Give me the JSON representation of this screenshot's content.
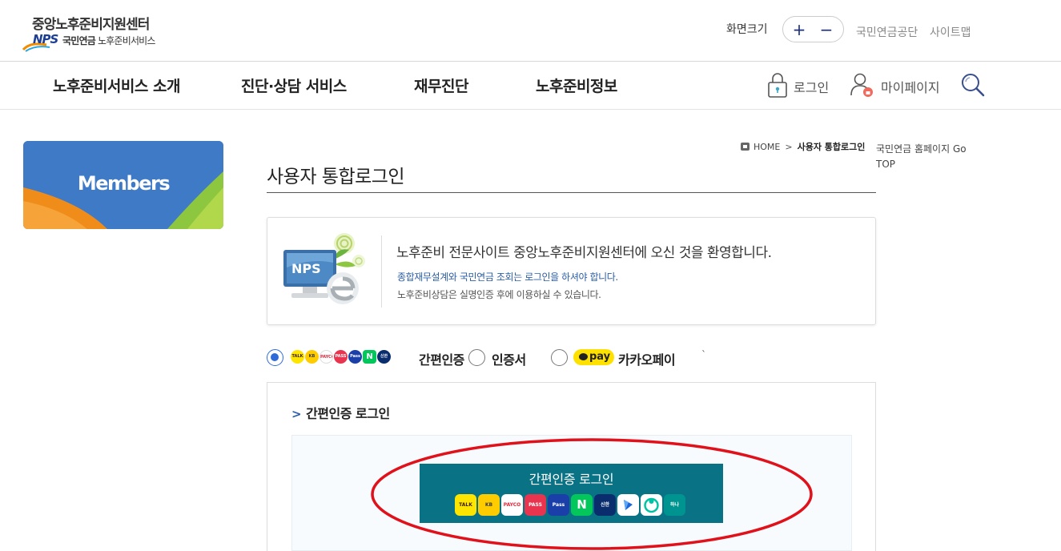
{
  "header": {
    "logo_title": "중앙노후준비지원센터",
    "logo_brand": "NPS",
    "logo_sub_bold": "국민연금",
    "logo_sub": "노후준비서비스",
    "zoom_label": "화면크기",
    "zoom_plus": "+",
    "zoom_minus": "−",
    "links": [
      "국민연금공단",
      "사이트맵"
    ]
  },
  "nav": {
    "items": [
      "노후준비서비스 소개",
      "진단·상담 서비스",
      "재무진단",
      "노후준비정보"
    ],
    "login_label": "로그인",
    "mypage_label": "마이페이지"
  },
  "side_banner": {
    "text": "Members"
  },
  "breadcrumb": {
    "home": "HOME",
    "sep": ">",
    "current": "사용자 통합로그인"
  },
  "go_links": "국민연금 홈페이지 Go TOP",
  "page_title": "사용자 통합로그인",
  "welcome": {
    "illust_text": "NPS",
    "main": "노후준비 전문사이트 중앙노후준비지원센터에 오신 것을 환영합니다.",
    "note1": "종합재무설계와 국민연금 조회는 로그인을 하셔야 합니다.",
    "note2": "노후준비상담은 실명인증 후에 이용하실 수 있습니다."
  },
  "login_methods": {
    "options": [
      "간편인증",
      "인증서",
      "카카오페이"
    ],
    "selected": "간편인증",
    "kakaopay_badge": "pay",
    "stray_mark": "`"
  },
  "simple_auth": {
    "heading_chevron": ">",
    "heading": "간편인증 로그인",
    "button_label": "간편인증 로그인",
    "provider_icons": [
      {
        "name": "kakao-talk",
        "text": "TALK",
        "bg": "#fee500",
        "fg": "#3c1e1e"
      },
      {
        "name": "kb",
        "text": "KB",
        "bg": "#ffcc00",
        "fg": "#3c3c3c"
      },
      {
        "name": "payco",
        "text": "PAYCO",
        "bg": "#ffffff",
        "fg": "#e0293b"
      },
      {
        "name": "pass",
        "text": "PASS",
        "bg": "#e8344e",
        "fg": "#ffffff"
      },
      {
        "name": "samsung-pass",
        "text": "Pass",
        "bg": "#1a3fa8",
        "fg": "#ffffff"
      },
      {
        "name": "naver",
        "text": "N",
        "bg": "#03c75a",
        "fg": "#ffffff"
      },
      {
        "name": "shinhan",
        "text": "신한",
        "bg": "#0a2d6e",
        "fg": "#ffffff"
      },
      {
        "name": "toss",
        "text": "",
        "bg": "#ffffff",
        "fg": "#1b64da"
      },
      {
        "name": "banksalad",
        "text": "",
        "bg": "#ffffff",
        "fg": "#00c3a5"
      },
      {
        "name": "hana",
        "text": "하나",
        "bg": "#009490",
        "fg": "#ffffff"
      }
    ]
  },
  "colors": {
    "accent_blue": "#2e6bd8",
    "auth_button": "#0a7285",
    "highlight_ring": "#e0111a",
    "banner_blue": "#3f7ac6"
  }
}
